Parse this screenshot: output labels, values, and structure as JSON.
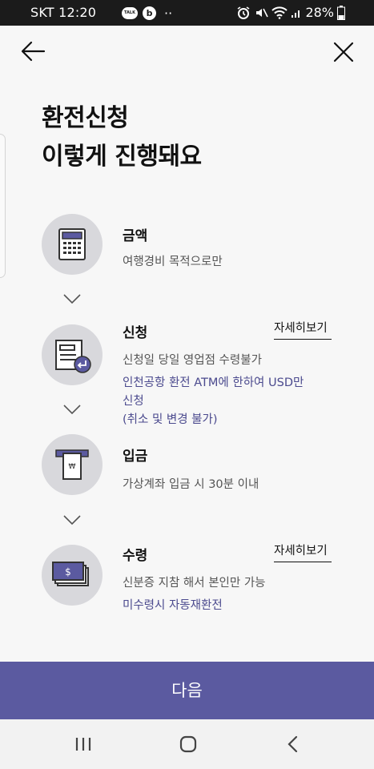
{
  "status_bar": {
    "carrier_time": "SKT 12:20",
    "talk_badge": "TALK",
    "b_badge": "b",
    "dots": "··",
    "battery": "28%"
  },
  "title": {
    "line1": "환전신청",
    "line2": "이렇게 진행돼요"
  },
  "steps": [
    {
      "title": "금액",
      "desc": "여행경비 목적으로만",
      "icon": "calculator-icon"
    },
    {
      "title": "신청",
      "detail_link": "자세히보기",
      "desc": "신청일 당일 영업점 수령불가",
      "note_line1": "인천공항 환전 ATM에 한하여 USD만",
      "note_line2": "신청",
      "note_line3": "(취소 및 변경 불가)",
      "icon": "application-form-icon"
    },
    {
      "title": "입금",
      "desc": "가상계좌 입금 시 30분 이내",
      "icon": "won-deposit-icon"
    },
    {
      "title": "수령",
      "detail_link": "자세히보기",
      "desc": "신분증 지참 해서 본인만 가능",
      "note_line1": "미수령시 자동재환전",
      "icon": "dollar-bills-icon"
    }
  ],
  "next_button": "다음",
  "colors": {
    "accent": "#5b5aa0",
    "note_text": "#4b4a8e",
    "icon_bg": "#d8d8dc"
  }
}
